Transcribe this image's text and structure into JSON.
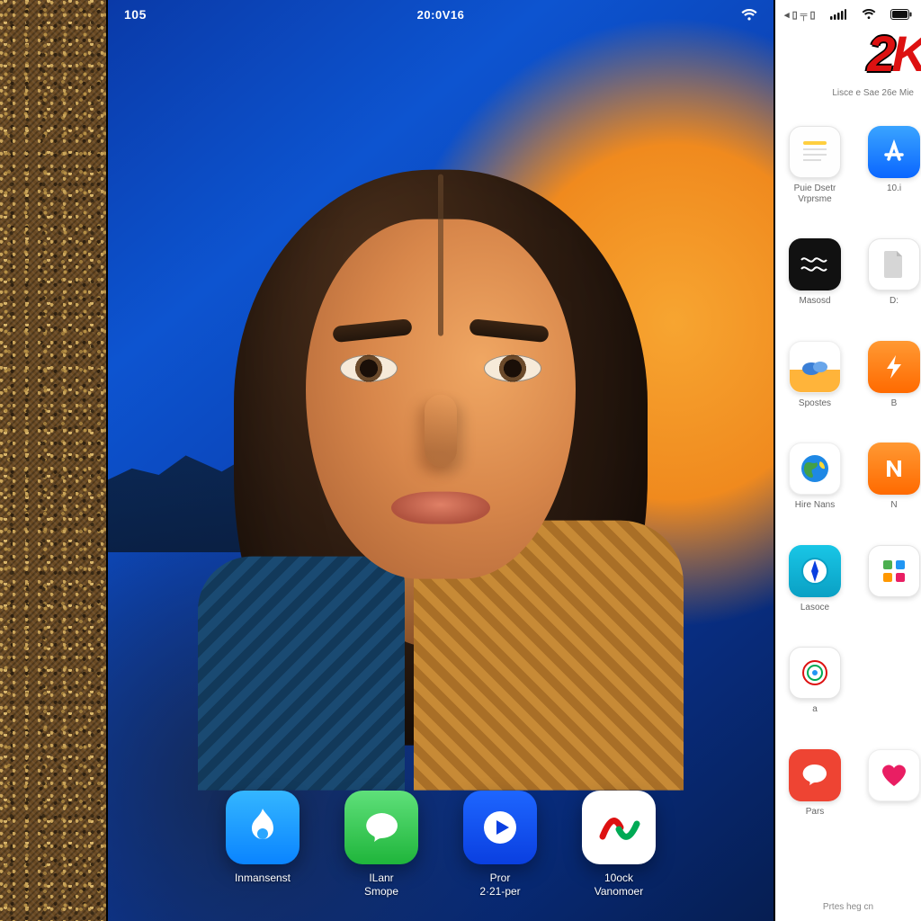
{
  "status_main": {
    "left": "105",
    "center": "20:0V16",
    "wifi": true,
    "signal": true
  },
  "status_side": {
    "carrier_bars": 5,
    "wifi": true,
    "battery": true,
    "back_indicator": "◂ ▯ ╤ ▯"
  },
  "dock": [
    {
      "id": "app-internet",
      "label": "Inmansenst",
      "sublabel": "",
      "icon": "flame-icon",
      "tile": "blue"
    },
    {
      "id": "app-store",
      "label": "ILanr",
      "sublabel": "Smope",
      "icon": "bubble-icon",
      "tile": "green"
    },
    {
      "id": "app-play",
      "label": "Pror",
      "sublabel": "2·21-per",
      "icon": "play-icon",
      "tile": "deepblue"
    },
    {
      "id": "app-wave",
      "label": "10ock",
      "sublabel": "Vanomoer",
      "icon": "swoosh-icon",
      "tile": "white"
    }
  ],
  "side_brand": {
    "logo_two": "2",
    "logo_k": "K",
    "subtitle": "Lisce e Sae 26e Mie"
  },
  "side_rows": [
    [
      {
        "id": "s-notes",
        "label": "Puie Dsetr",
        "sublabel": "Vrprsme",
        "icon": "notes-icon",
        "tile": "st-notes"
      },
      {
        "id": "s-appstore",
        "label": "10.i",
        "sublabel": "",
        "icon": "a-badge-icon",
        "tile": "st-blue"
      }
    ],
    [
      {
        "id": "s-music",
        "label": "Masosd",
        "sublabel": "",
        "icon": "waves-icon",
        "tile": "st-black"
      },
      {
        "id": "s-doc",
        "label": "D:",
        "sublabel": "",
        "icon": "doc-icon",
        "tile": "st-white"
      }
    ],
    [
      {
        "id": "s-weather",
        "label": "Spostes",
        "sublabel": "",
        "icon": "cloud-icon",
        "tile": "st-weather"
      },
      {
        "id": "s-orange",
        "label": "B",
        "sublabel": "",
        "icon": "bolt-icon",
        "tile": "st-orange"
      }
    ],
    [
      {
        "id": "s-globe",
        "label": "Hire Nans",
        "sublabel": "",
        "icon": "globe-icon",
        "tile": "st-globe"
      },
      {
        "id": "s-red",
        "label": "N",
        "sublabel": "",
        "icon": "n-icon",
        "tile": "st-orange"
      }
    ],
    [
      {
        "id": "s-compass",
        "label": "Lasoce",
        "sublabel": "",
        "icon": "compass-icon",
        "tile": "st-compass"
      },
      {
        "id": "s-blank",
        "label": "",
        "sublabel": "",
        "icon": "grid-icon",
        "tile": "st-white"
      }
    ],
    [
      {
        "id": "s-target",
        "label": "a",
        "sublabel": "",
        "icon": "target-icon",
        "tile": "st-white"
      },
      {
        "id": "",
        "label": "",
        "sublabel": "",
        "icon": "",
        "tile": ""
      }
    ],
    [
      {
        "id": "s-chat",
        "label": "Pars",
        "sublabel": "",
        "icon": "chat-icon",
        "tile": "st-red"
      },
      {
        "id": "s-heart",
        "label": "",
        "sublabel": "",
        "icon": "heart-icon",
        "tile": "st-multi"
      }
    ]
  ],
  "side_footer": "Prtes   heg cn"
}
